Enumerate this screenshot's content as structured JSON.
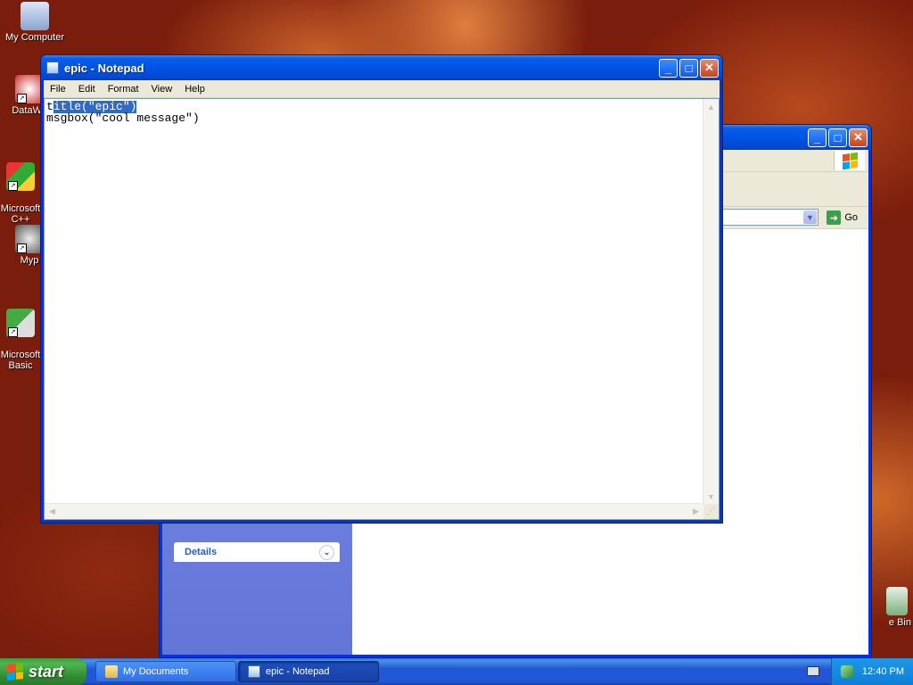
{
  "desktop": {
    "icons": [
      {
        "label": "My Computer",
        "icon": "my-computer-icon"
      },
      {
        "label": "DataWa",
        "icon": "datawa-icon"
      },
      {
        "label": "Microsoft\nC++",
        "icon": "microsoft-cpp-icon"
      },
      {
        "label": "Myp",
        "icon": "myp-icon"
      },
      {
        "label": "Microsoft\nBasic",
        "icon": "microsoft-basic-icon"
      },
      {
        "label": "e Bin",
        "icon": "recycle-bin-icon"
      }
    ]
  },
  "notepad": {
    "title": "epic - Notepad",
    "menu": [
      "File",
      "Edit",
      "Format",
      "View",
      "Help"
    ],
    "text_line1_pre": "t",
    "text_line1_sel": "itle(\"epic\")",
    "text_line2": "msgbox(\"cool message\")"
  },
  "explorer": {
    "go_label": "Go",
    "details_label": "Details"
  },
  "taskbar": {
    "start_label": "start",
    "buttons": [
      {
        "label": "My Documents",
        "active": false
      },
      {
        "label": "epic - Notepad",
        "active": true
      }
    ],
    "clock": "12:40 PM"
  },
  "colors": {
    "xp_blue": "#0054e3",
    "selection": "#316ac5",
    "start_green": "#3c9a3c"
  }
}
